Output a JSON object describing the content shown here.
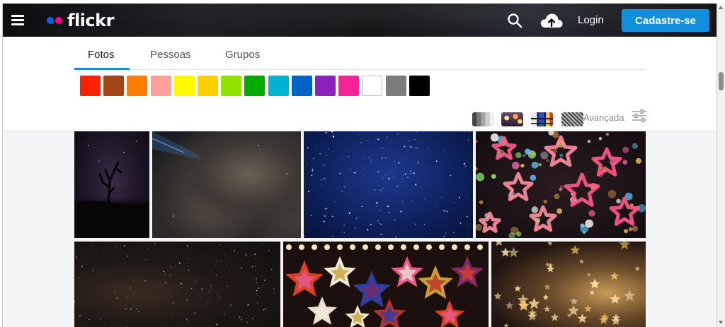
{
  "header": {
    "menu_icon": "hamburger-menu-icon",
    "logo_text": "flickr",
    "logo_colors": [
      "#0063dc",
      "#ff0084"
    ],
    "search_icon": "search-icon",
    "upload_icon": "cloud-upload-icon",
    "login_label": "Login",
    "signup_label": "Cadastre-se",
    "signup_color": "#128fdc"
  },
  "tabs": [
    {
      "label": "Fotos",
      "active": true
    },
    {
      "label": "Pessoas",
      "active": false
    },
    {
      "label": "Grupos",
      "active": false
    }
  ],
  "colors": [
    {
      "name": "red",
      "hex": "#ff2000"
    },
    {
      "name": "brown",
      "hex": "#a24615"
    },
    {
      "name": "orange",
      "hex": "#ff7c00"
    },
    {
      "name": "pink",
      "hex": "#ff9f9c"
    },
    {
      "name": "yellow",
      "hex": "#fffa00"
    },
    {
      "name": "gold",
      "hex": "#ffcf00"
    },
    {
      "name": "lime",
      "hex": "#90e200"
    },
    {
      "name": "green",
      "hex": "#00ab00"
    },
    {
      "name": "teal",
      "hex": "#00b2d4"
    },
    {
      "name": "blue",
      "hex": "#0062c6"
    },
    {
      "name": "purple",
      "hex": "#8c20ba"
    },
    {
      "name": "magenta",
      "hex": "#f52394"
    },
    {
      "name": "white",
      "hex": "#ffffff"
    },
    {
      "name": "gray",
      "hex": "#7c7c7c"
    },
    {
      "name": "black",
      "hex": "#000000"
    }
  ],
  "styles": [
    {
      "name": "black-and-white-style-icon"
    },
    {
      "name": "shallow-depth-of-field-style-icon"
    },
    {
      "name": "minimalist-style-icon"
    },
    {
      "name": "patterns-style-icon"
    }
  ],
  "advanced_label": "Avançada",
  "advanced_icon": "sliders-icon",
  "photos": [
    {
      "name": "photo-dead-tree-night-sky"
    },
    {
      "name": "photo-milky-way-clouds"
    },
    {
      "name": "photo-blue-starry-sky"
    },
    {
      "name": "photo-bokeh-star-lights"
    },
    {
      "name": "photo-dark-starry-sky"
    },
    {
      "name": "photo-paper-star-lanterns"
    },
    {
      "name": "photo-golden-star-confetti"
    }
  ]
}
